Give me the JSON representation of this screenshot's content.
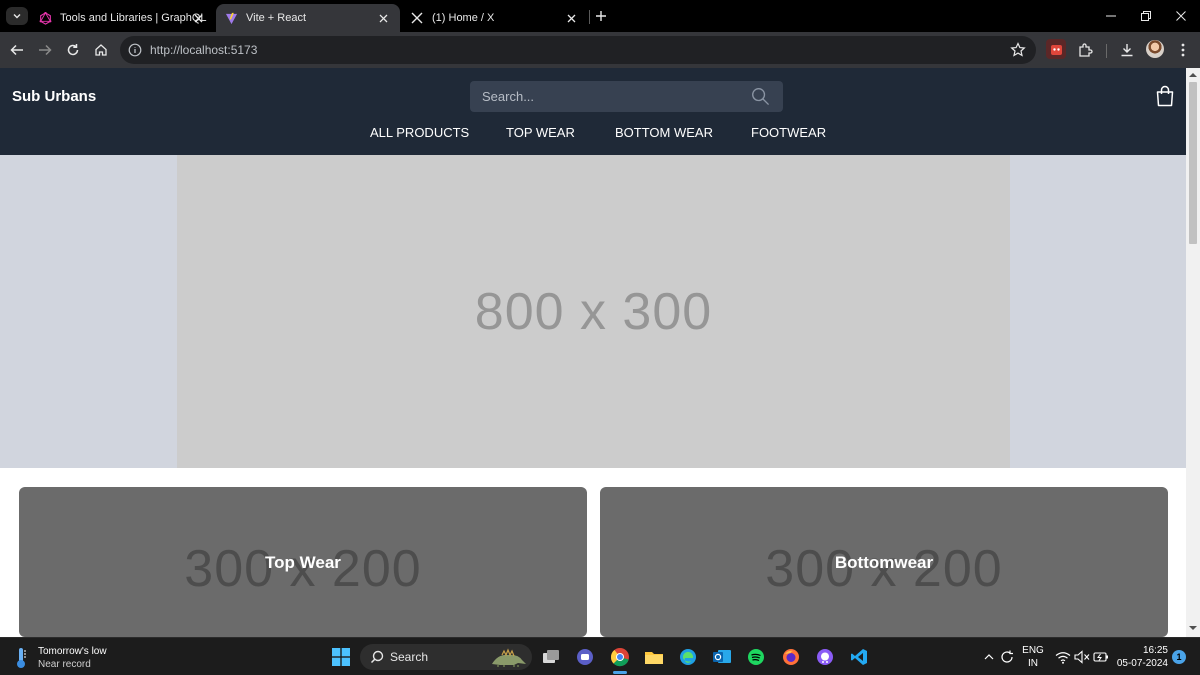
{
  "browser": {
    "tabs": [
      {
        "title": "Tools and Libraries | GraphQL",
        "icon": "graphql-logo-icon",
        "active": false
      },
      {
        "title": "Vite + React",
        "icon": "vite-logo-icon",
        "active": true
      },
      {
        "title": "(1) Home / X",
        "icon": "x-logo-icon",
        "active": false
      }
    ],
    "url": "http://localhost:5173"
  },
  "site": {
    "logo": "Sub Urbans",
    "search_placeholder": "Search...",
    "nav": [
      "ALL PRODUCTS",
      "TOP WEAR",
      "BOTTOM WEAR",
      "FOOTWEAR"
    ],
    "hero_placeholder": "800 x 300",
    "categories": [
      {
        "label": "Top Wear",
        "placeholder": "300 x 200"
      },
      {
        "label": "Bottomwear",
        "placeholder": "300 x 200"
      }
    ],
    "colors": {
      "navbar": "#1f2937",
      "search_bg": "#374151",
      "hero_bg": "#d1d5de"
    }
  },
  "taskbar": {
    "weather_title": "Tomorrow's low",
    "weather_sub": "Near record",
    "search_label": "Search",
    "lang_line1": "ENG",
    "lang_line2": "IN",
    "time": "16:25",
    "date": "05-07-2024",
    "notification_count": "1"
  }
}
